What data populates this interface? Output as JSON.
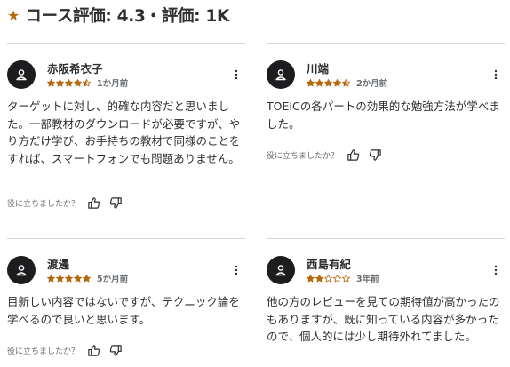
{
  "header": {
    "star_icon": "star-icon",
    "title": "コース評価: 4.3・評価: 1K"
  },
  "colors": {
    "star": "#b4690e",
    "avatar": "#1c1d1f",
    "divider": "#d1d7dc"
  },
  "reviews": [
    {
      "name": "赤阪希衣子",
      "rating": 4.5,
      "time": "1か月前",
      "body": "ターゲットに対し、的確な内容だと思いました。一部教材のダウンロードが必要ですが、やり方だけ学び、お手持ちの教材で同様のことをすれば、スマートフォンでも問題ありません。",
      "helpful_question": "役に立ちましたか？"
    },
    {
      "name": "川端",
      "rating": 4.5,
      "time": "2か月前",
      "body": "TOEICの各パートの効果的な勉強方法が学べました。",
      "helpful_question": "役に立ちましたか？"
    },
    {
      "name": "渡邊",
      "rating": 5,
      "time": "5か月前",
      "body": "目新しい内容ではないですが、テクニック論を学べるので良いと思います。",
      "helpful_question": "役に立ちましたか？"
    },
    {
      "name": "西島有紀",
      "rating": 2,
      "time": "3年前",
      "body": "他の方のレビューを見ての期待値が高かったのもありますが、既に知っている内容が多かったので、個人的には少し期待外れてました。",
      "helpful_question": "役に立ちましたか？"
    }
  ]
}
